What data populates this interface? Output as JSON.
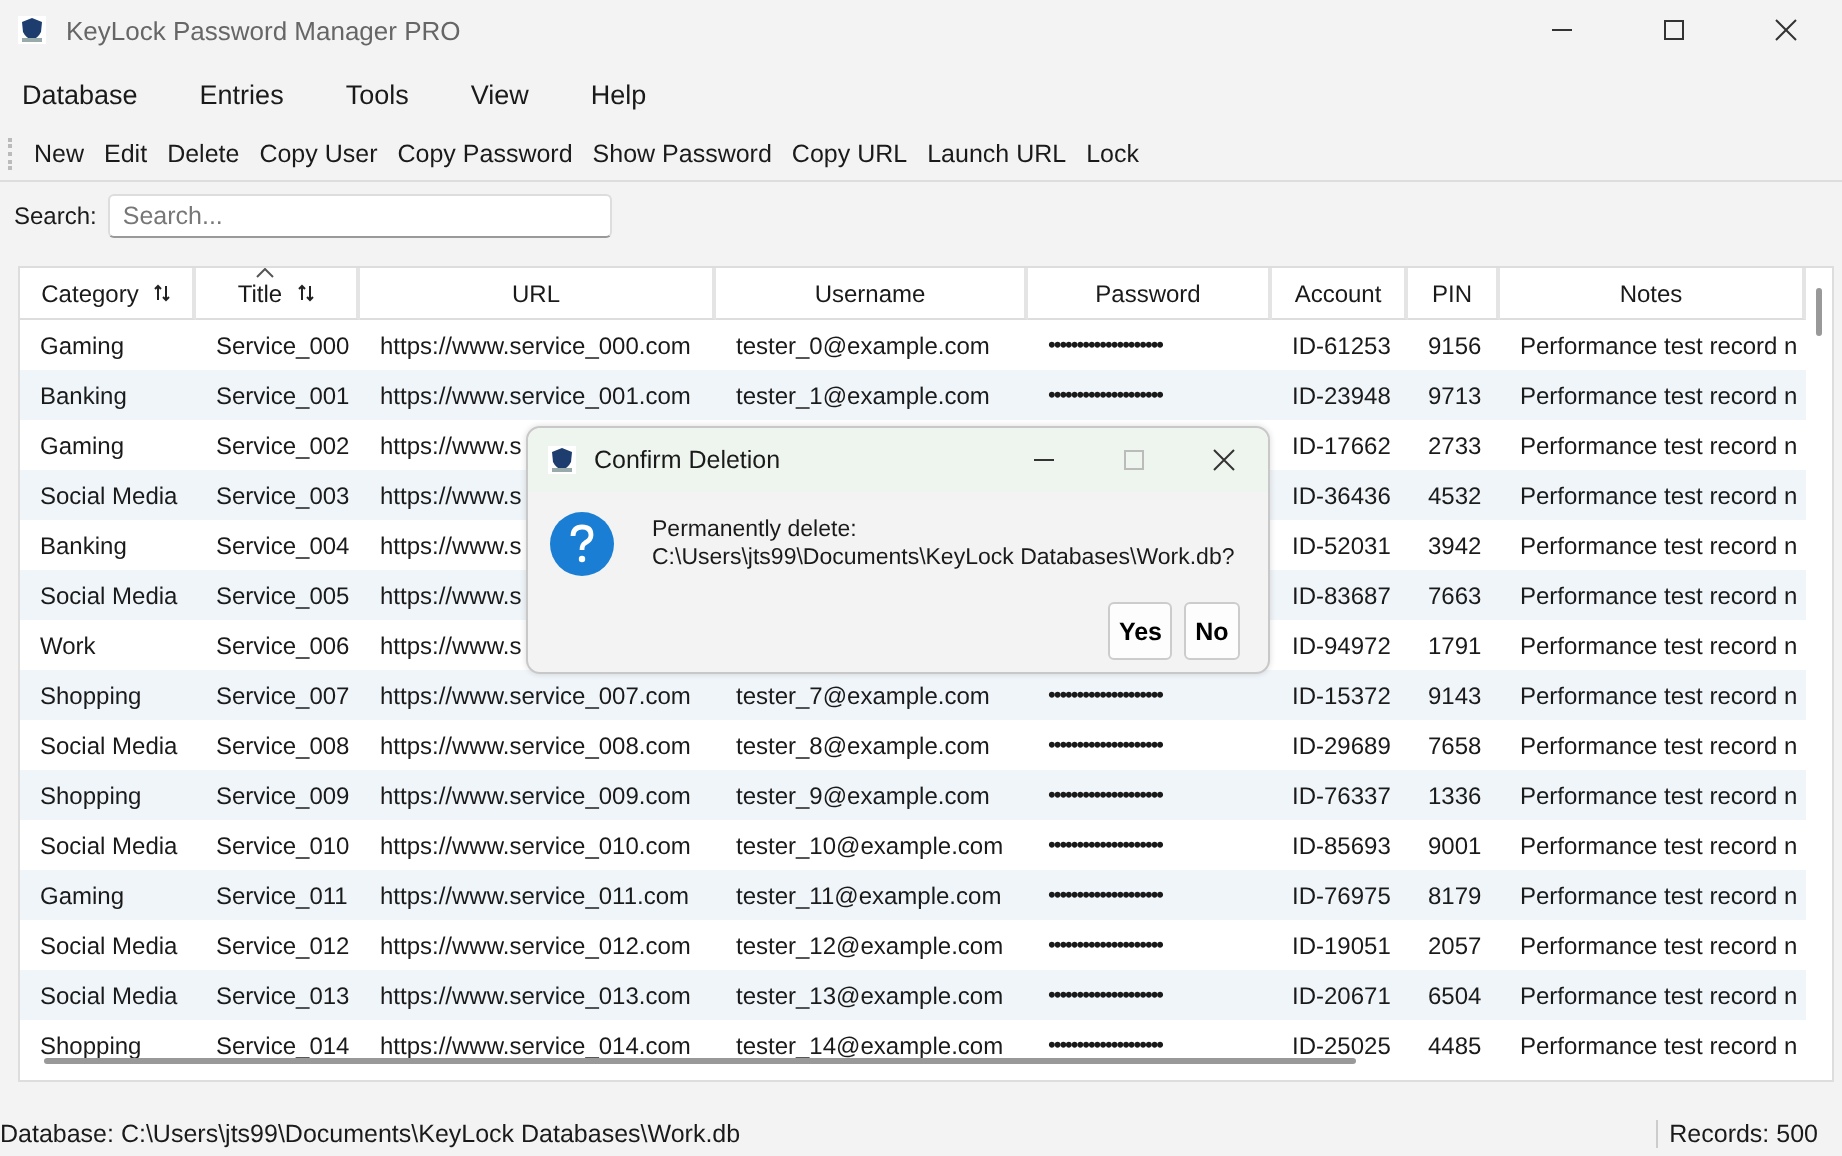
{
  "window": {
    "title": "KeyLock Password Manager PRO"
  },
  "menu": [
    "Database",
    "Entries",
    "Tools",
    "View",
    "Help"
  ],
  "toolbar": [
    "New",
    "Edit",
    "Delete",
    "Copy User",
    "Copy Password",
    "Show Password",
    "Copy URL",
    "Launch URL",
    "Lock"
  ],
  "search": {
    "label": "Search:",
    "placeholder": "Search..."
  },
  "table": {
    "columns": [
      {
        "label": "Category",
        "sortable": true,
        "sorted": false
      },
      {
        "label": "Title",
        "sortable": true,
        "sorted": true
      },
      {
        "label": "URL",
        "sortable": false,
        "sorted": false
      },
      {
        "label": "Username",
        "sortable": false,
        "sorted": false
      },
      {
        "label": "Password",
        "sortable": false,
        "sorted": false
      },
      {
        "label": "Account",
        "sortable": false,
        "sorted": false
      },
      {
        "label": "PIN",
        "sortable": false,
        "sorted": false
      },
      {
        "label": "Notes",
        "sortable": false,
        "sorted": false
      }
    ],
    "rows": [
      {
        "cells": [
          "Gaming",
          "Service_000",
          "https://www.service_000.com",
          "tester_0@example.com",
          "••••••••••••••••••••",
          "ID-61253",
          "9156",
          "Performance test record n"
        ]
      },
      {
        "cells": [
          "Banking",
          "Service_001",
          "https://www.service_001.com",
          "tester_1@example.com",
          "••••••••••••••••••••",
          "ID-23948",
          "9713",
          "Performance test record n"
        ]
      },
      {
        "cells": [
          "Gaming",
          "Service_002",
          "https://www.s",
          null,
          null,
          "ID-17662",
          "2733",
          "Performance test record n"
        ]
      },
      {
        "cells": [
          "Social Media",
          "Service_003",
          "https://www.s",
          null,
          null,
          "ID-36436",
          "4532",
          "Performance test record n"
        ]
      },
      {
        "cells": [
          "Banking",
          "Service_004",
          "https://www.s",
          null,
          null,
          "ID-52031",
          "3942",
          "Performance test record n"
        ]
      },
      {
        "cells": [
          "Social Media",
          "Service_005",
          "https://www.s",
          null,
          null,
          "ID-83687",
          "7663",
          "Performance test record n"
        ]
      },
      {
        "cells": [
          "Work",
          "Service_006",
          "https://www.s",
          null,
          null,
          "ID-94972",
          "1791",
          "Performance test record n"
        ]
      },
      {
        "cells": [
          "Shopping",
          "Service_007",
          "https://www.service_007.com",
          "tester_7@example.com",
          "••••••••••••••••••••",
          "ID-15372",
          "9143",
          "Performance test record n"
        ]
      },
      {
        "cells": [
          "Social Media",
          "Service_008",
          "https://www.service_008.com",
          "tester_8@example.com",
          "••••••••••••••••••••",
          "ID-29689",
          "7658",
          "Performance test record n"
        ]
      },
      {
        "cells": [
          "Shopping",
          "Service_009",
          "https://www.service_009.com",
          "tester_9@example.com",
          "••••••••••••••••••••",
          "ID-76337",
          "1336",
          "Performance test record n"
        ]
      },
      {
        "cells": [
          "Social Media",
          "Service_010",
          "https://www.service_010.com",
          "tester_10@example.com",
          "••••••••••••••••••••",
          "ID-85693",
          "9001",
          "Performance test record n"
        ]
      },
      {
        "cells": [
          "Gaming",
          "Service_011",
          "https://www.service_011.com",
          "tester_11@example.com",
          "••••••••••••••••••••",
          "ID-76975",
          "8179",
          "Performance test record n"
        ]
      },
      {
        "cells": [
          "Social Media",
          "Service_012",
          "https://www.service_012.com",
          "tester_12@example.com",
          "••••••••••••••••••••",
          "ID-19051",
          "2057",
          "Performance test record n"
        ]
      },
      {
        "cells": [
          "Social Media",
          "Service_013",
          "https://www.service_013.com",
          "tester_13@example.com",
          "••••••••••••••••••••",
          "ID-20671",
          "6504",
          "Performance test record n"
        ]
      },
      {
        "cells": [
          "Shopping",
          "Service_014",
          "https://www.service_014.com",
          "tester_14@example.com",
          "••••••••••••••••••••",
          "ID-25025",
          "4485",
          "Performance test record n"
        ]
      }
    ]
  },
  "status_bar": {
    "database": "Database: C:\\Users\\jts99\\Documents\\KeyLock Databases\\Work.db",
    "records": "Records: 500"
  },
  "dialog": {
    "title": "Confirm Deletion",
    "message": "Permanently delete:",
    "path": "C:\\Users\\jts99\\Documents\\KeyLock Databases\\Work.db?",
    "buttons": [
      "Yes",
      "No"
    ]
  }
}
